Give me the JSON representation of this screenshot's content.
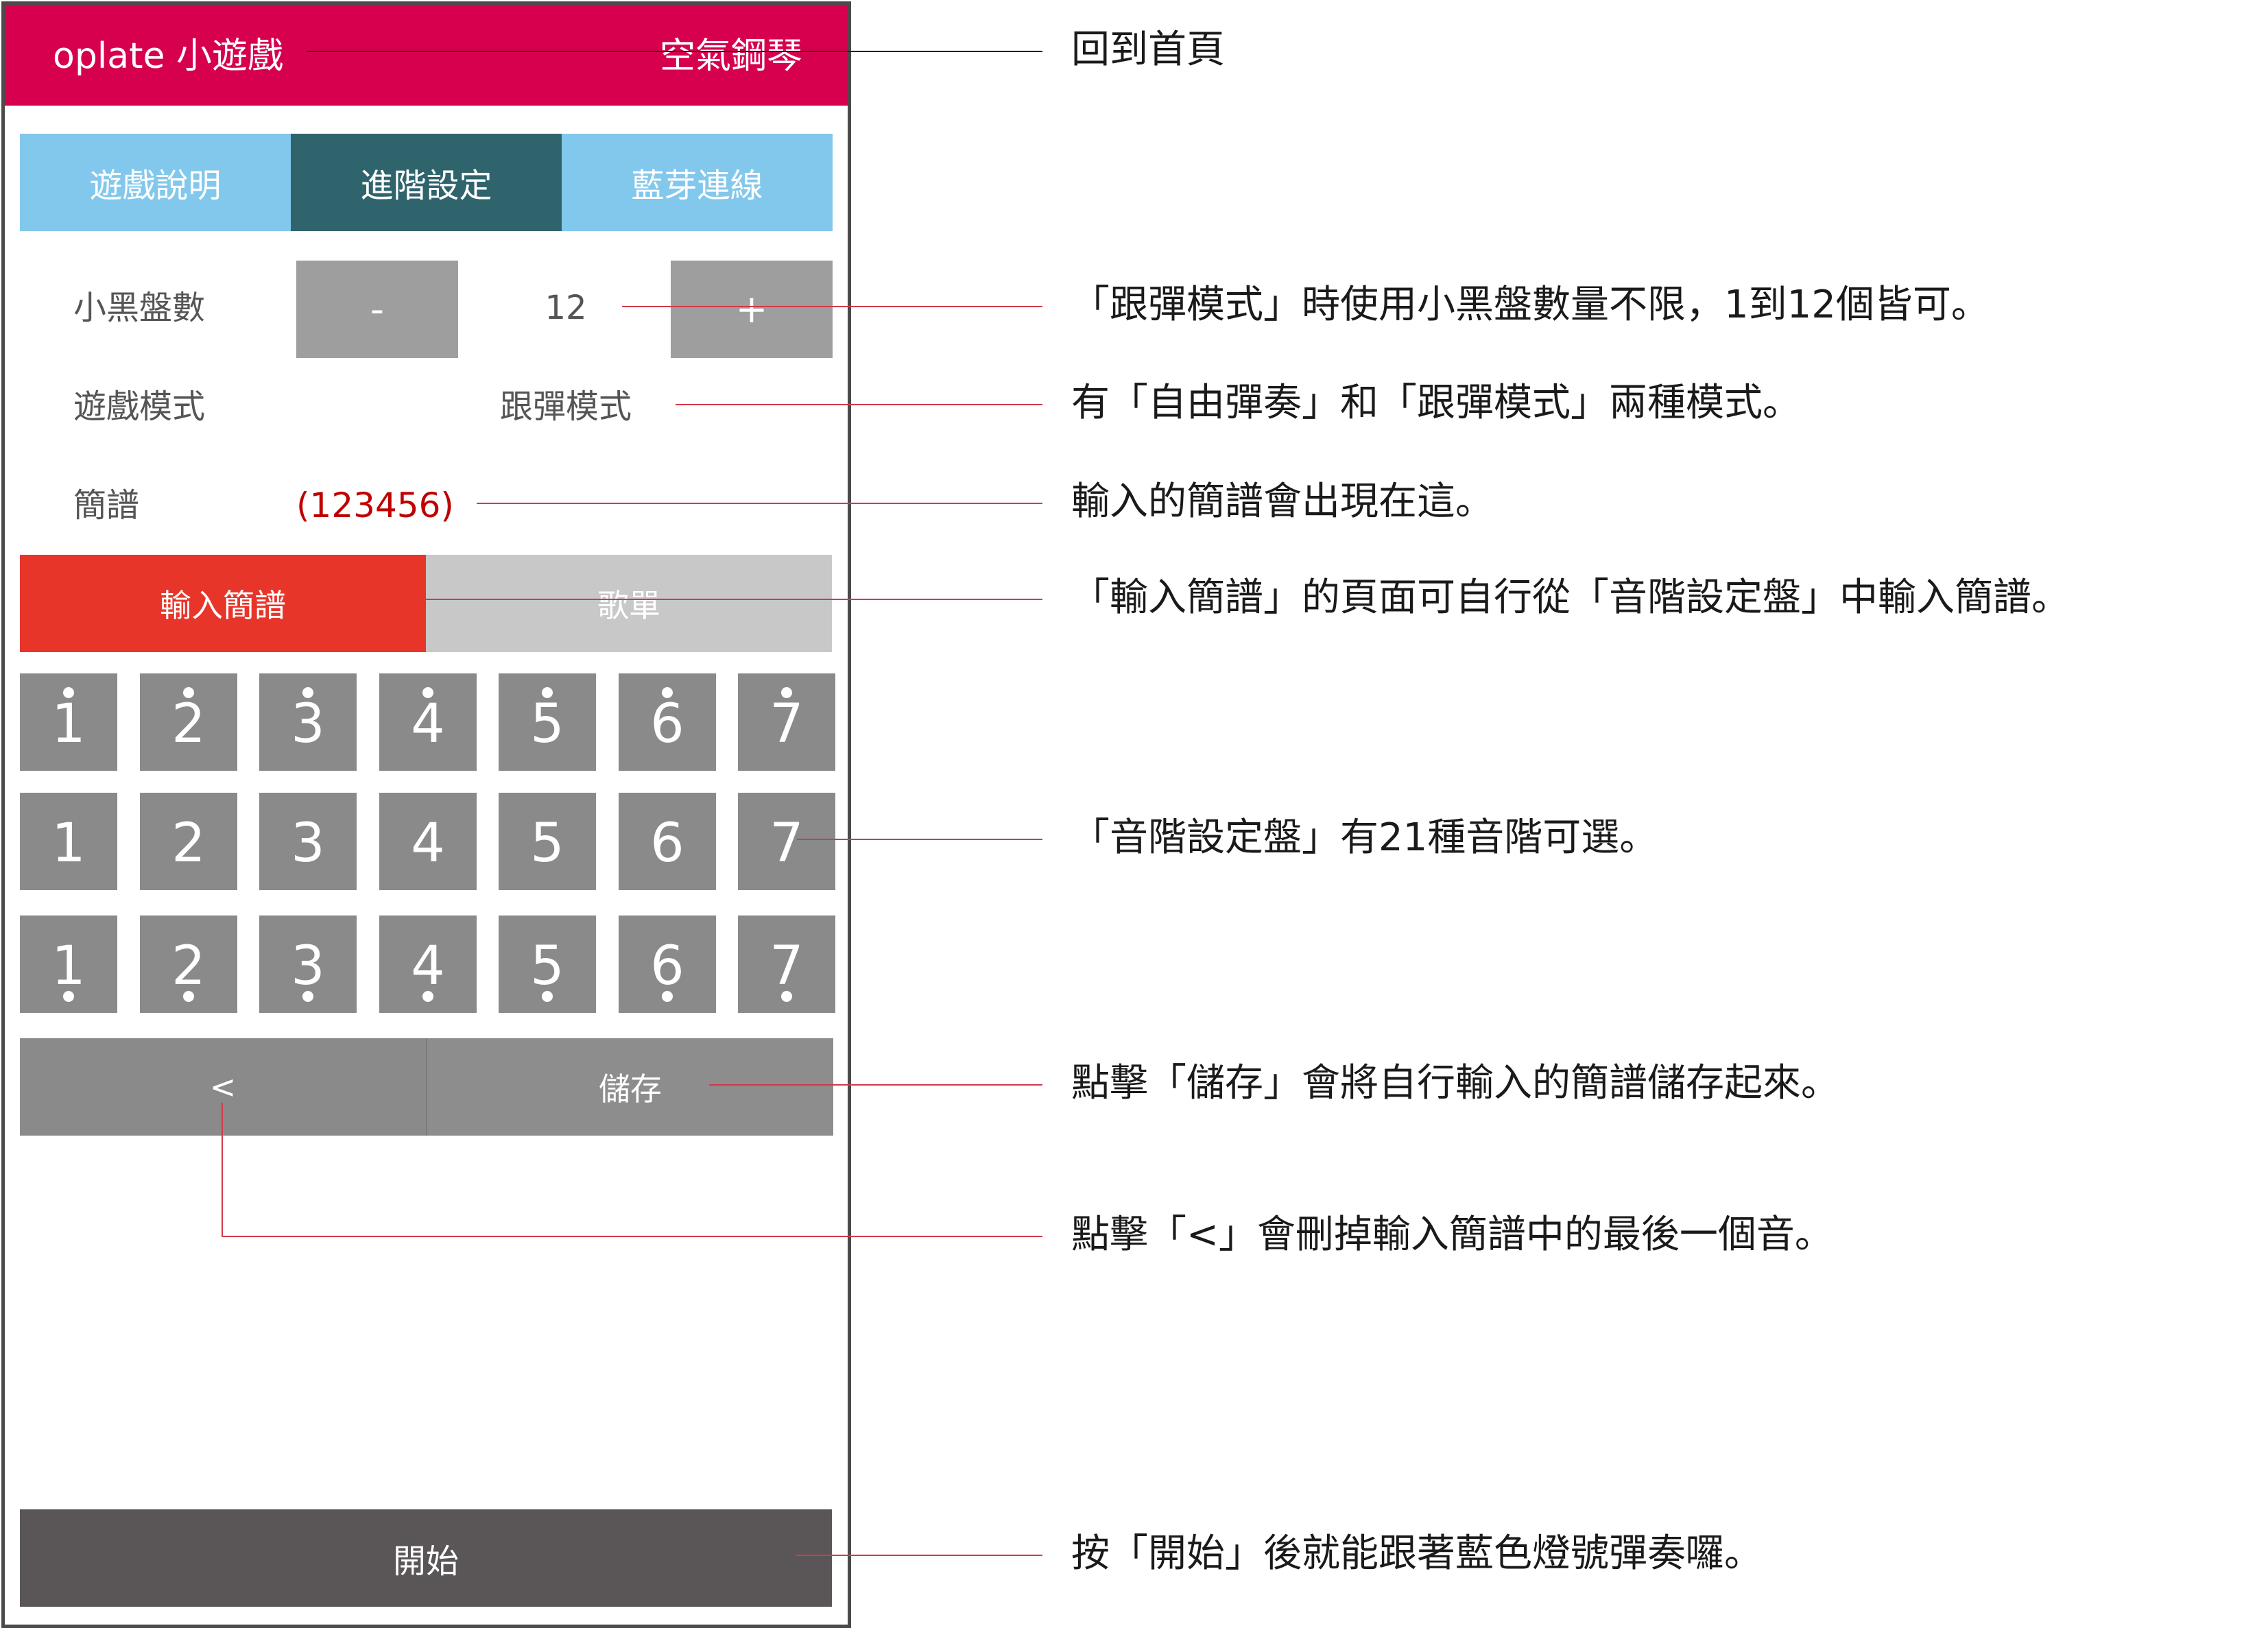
{
  "header": {
    "app_title": "oplate 小遊戲",
    "home_link": "空氣鋼琴"
  },
  "tabs": [
    {
      "label": "遊戲說明"
    },
    {
      "label": "進階設定"
    },
    {
      "label": "藍芽連線"
    }
  ],
  "settings": {
    "disc_count_label": "小黑盤數",
    "minus_label": "-",
    "disc_count_value": "12",
    "plus_label": "+",
    "game_mode_label": "遊戲模式",
    "game_mode_value": "跟彈模式",
    "notation_label": "簡譜",
    "notation_value": "(123456)"
  },
  "input_toggle": {
    "input_label": "輸入簡譜",
    "songs_label": "歌單"
  },
  "scale_keys": {
    "high": [
      "1",
      "2",
      "3",
      "4",
      "5",
      "6",
      "7"
    ],
    "middle": [
      "1",
      "2",
      "3",
      "4",
      "5",
      "6",
      "7"
    ],
    "low": [
      "1",
      "2",
      "3",
      "4",
      "5",
      "6",
      "7"
    ]
  },
  "actions": {
    "back_label": "<",
    "save_label": "儲存"
  },
  "start_label": "開始",
  "annotations": {
    "home": "回到首頁",
    "disc_count": "「跟彈模式」時使用小黑盤數量不限，1到12個皆可。",
    "mode": "有「自由彈奏」和「跟彈模式」兩種模式。",
    "notation": "輸入的簡譜會出現在這。",
    "input": "「輸入簡譜」的頁面可自行從「音階設定盤」中輸入簡譜。",
    "scale": "「音階設定盤」有21種音階可選。",
    "save": "點擊「儲存」會將自行輸入的簡譜儲存起來。",
    "back": "點擊「<」會刪掉輸入簡譜中的最後一個音。",
    "start": "按「開始」後就能跟著藍色燈號彈奏囉。"
  },
  "colors": {
    "header": "#d6004f",
    "tab_inactive": "#82c8ec",
    "tab_active": "#2f646c",
    "input_active": "#e8352a",
    "key": "#8a8a8a",
    "start": "#5a5657",
    "notation": "#c00000",
    "leader": "#d23a4a"
  }
}
